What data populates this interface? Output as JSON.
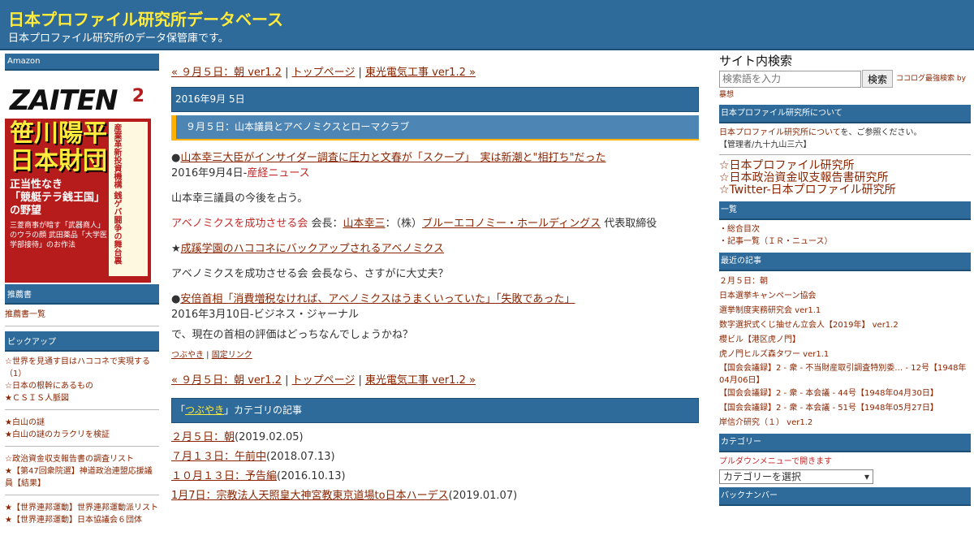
{
  "header": {
    "title": "日本プロファイル研究所データベース",
    "description": "日本プロファイル研究所のデータ保管庫です。"
  },
  "left": {
    "amazon_title": "Amazon",
    "magazine": {
      "logo": "ZAITEN",
      "issue": "2",
      "headline": "笹川陽平\n日本財団",
      "sub": "正当性なき\n「競艇テラ銭王国」\nの野望",
      "side": "産業革新投資機構 銭ゲバ闘争の舞台裏",
      "small": "三菱商事が暗す「武器商人」のウラの顔 武田薬品「大学医学部接待」のお作法"
    },
    "recommend_title": "推薦書",
    "recommend_items": [
      "推薦書一覧"
    ],
    "pickup_title": "ピックアップ",
    "pickup_group1": [
      "☆世界を見通す目はハココネで実現する（1）",
      "☆日本の根幹にあるもの",
      "★ＣＳＩＳ人脈図"
    ],
    "pickup_group2": [
      "★白山の謎",
      "★白山の謎のカラクリを検証"
    ],
    "pickup_group3": [
      "☆政治資金収支報告書の調査リスト",
      "★【第47回衆院選】神道政治連盟応援議員【結果】"
    ],
    "pickup_group4": [
      "★【世界連邦運動】世界連邦運動派リスト",
      "★【世界連邦運動】日本協議会６団体"
    ]
  },
  "main": {
    "nav": {
      "prev": "« ９月５日：朝 ver1.2",
      "sep1": " | ",
      "top": "トップページ",
      "sep2": " | ",
      "next": "東光電気工事 ver1.2 »"
    },
    "date": "2016年9月 5日",
    "entry_title": "９月５日：山本議員とアベノミクスとローマクラブ",
    "p1_bullet": "●",
    "p1_link": "山本幸三大臣がインサイダー調査に圧力と文春が「スクープ」　実は新潮と\"相打ち\"だった",
    "p1_date": "2016年9月4日-",
    "p1_source": "産経ニュース",
    "p2": "山本幸三議員の今後を占う。",
    "p3_org": "アベノミクスを成功させる会",
    "p3_mid": " 会長：",
    "p3_name": "山本幸三",
    "p3_mid2": "：（株）",
    "p3_company": "ブルーエコノミー・ホールディングス",
    "p3_end": " 代表取締役",
    "p4_star": "★",
    "p4_link": "成蹊学園のハココネにバックアップされるアベノミクス",
    "p5": "アベノミクスを成功させる会 会長なら、さすがに大丈夫？",
    "p6_bullet": "●",
    "p6_link": "安倍首相「消費増税なければ、アベノミクスはうまくいっていた」「失敗であった」",
    "p6_date": "2016年3月10日-ビジネス・ジャーナル",
    "p7": "で、現在の首相の評価はどっちなんでしょうかね？",
    "footer_cat": "つぶやき",
    "footer_sep": " | ",
    "footer_link": "固定リンク",
    "cat_pre": "「",
    "cat_name": "つぶやき",
    "cat_post": "」カテゴリの記事",
    "recent": [
      {
        "title": "２月５日：朝",
        "date": "(2019.02.05)"
      },
      {
        "title": "７月１３日：午前中",
        "date": "(2018.07.13)"
      },
      {
        "title": "１０月１３日：予告編",
        "date": "(2016.10.13)"
      },
      {
        "title": "1月7日：宗教法人天照皇大神宮教東京道場to日本ハーデス",
        "date": "(2019.01.07)"
      }
    ]
  },
  "right": {
    "search_title": "サイト内検索",
    "search_placeholder": "検索語を入力",
    "search_button": "検索",
    "search_note": "ココログ最強検索 by",
    "search_note2": "暴想",
    "about_title": "日本プロファイル研究所について",
    "about_link": "日本プロファイル研究所について",
    "about_text": "を、ご参照ください。",
    "admin": "【管理者/九十九山三六】",
    "big_links": [
      "☆日本プロファイル研究所",
      "☆日本政治資金収支報告書研究所",
      "☆Twitter-日本プロファイル研究所"
    ],
    "list_title": "一覧",
    "list_items": [
      "・総合目次",
      "・記事一覧（ＩＲ・ニュース）"
    ],
    "recent_title": "最近の記事",
    "recent_items": [
      "２月５日：朝",
      "日本選挙キャンペーン協会",
      "選挙制度実務研究会 ver1.1",
      "数字選択式くじ抽せん立会人【2019年】 ver1.2",
      "櫻ビル【港区虎ノ門】",
      "虎ノ門ヒルズ森タワー ver1.1",
      "【国会会議録】2 - 衆 - 不当財産取引調査特別委… - 12号【1948年04月06日】",
      "【国会会議録】2 - 衆 - 本会議 - 44号【1948年04月30日】",
      "【国会会議録】2 - 衆 - 本会議 - 51号【1948年05月27日】",
      "岸信介研究（１） ver1.2"
    ],
    "category_title": "カテゴリー",
    "category_note": "プルダウンメニューで開きます",
    "category_select": "カテゴリーを選択",
    "backnumber_title": "バックナンバー"
  }
}
